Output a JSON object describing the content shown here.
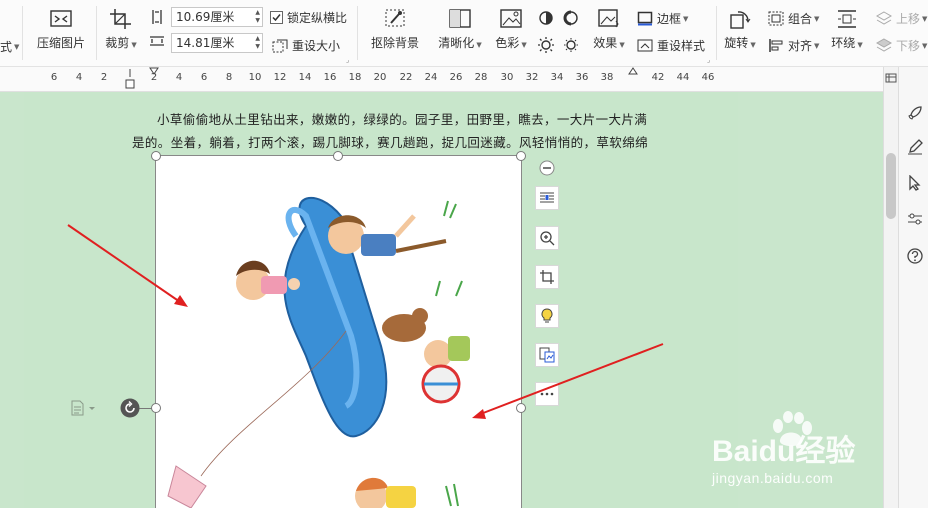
{
  "toolbar": {
    "left_cut_label": "式",
    "compress_label": "压缩图片",
    "crop_label": "裁剪",
    "height_value": "10.69厘米",
    "width_value": "14.81厘米",
    "lock_ratio_label": "锁定纵横比",
    "reset_size_label": "重设大小",
    "remove_bg_label": "抠除背景",
    "sharpen_label": "清晰化",
    "color_label": "色彩",
    "effects_label": "效果",
    "border_label": "边框",
    "reset_style_label": "重设样式",
    "rotate_label": "旋转",
    "group_label": "组合",
    "align_label": "对齐",
    "wrap_label": "环绕",
    "move_up_label": "上移",
    "move_down_label": "下移"
  },
  "ruler": {
    "ticks": [
      "6",
      "4",
      "2",
      "2",
      "4",
      "6",
      "8",
      "10",
      "12",
      "14",
      "16",
      "18",
      "20",
      "22",
      "24",
      "26",
      "28",
      "30",
      "32",
      "34",
      "36",
      "38",
      "42",
      "44",
      "46"
    ]
  },
  "document": {
    "line1": "小草偷偷地从土里钻出来，嫩嫩的，绿绿的。园子里，田野里，瞧去，一大片一大片满",
    "line2": "是的。坐着，躺着，打两个滚，踢几脚球，赛几趟跑，捉几回迷藏。风轻悄悄的，草软绵绵"
  },
  "watermark": {
    "brand": "Baidu经验",
    "url": "jingyan.baidu.com"
  },
  "colors": {
    "page_bg": "#c8e6cb",
    "arrow": "#e02020",
    "toolbar_bg": "#fbfbfb"
  }
}
